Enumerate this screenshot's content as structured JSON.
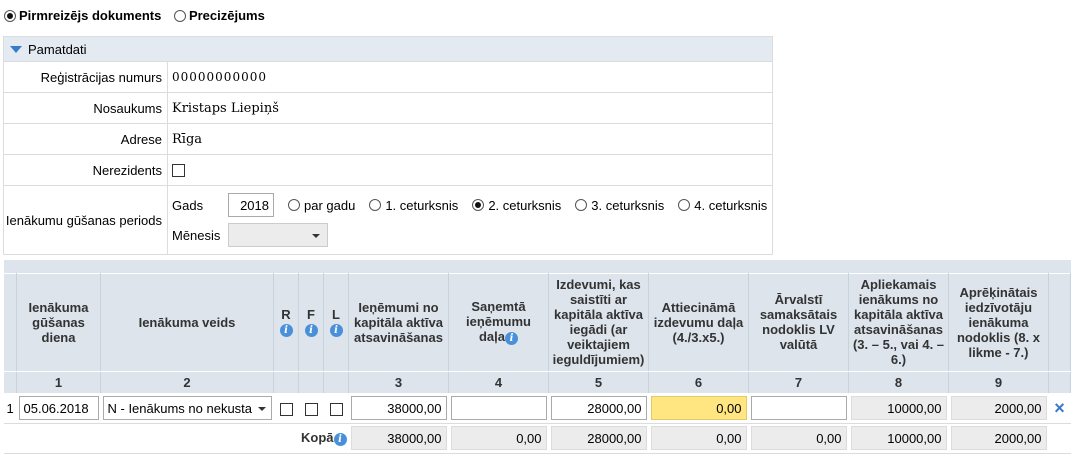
{
  "doc_type": {
    "options": [
      {
        "label": "Pirmreizējs dokuments",
        "selected": true
      },
      {
        "label": "Precizējums",
        "selected": false
      }
    ]
  },
  "pamatdati": {
    "title": "Pamatdati",
    "reg_label": "Reģistrācijas numurs",
    "reg_value": "00000000000",
    "name_label": "Nosaukums",
    "name_value": "Kristaps Liepiņš",
    "address_label": "Adrese",
    "address_value": "Rīga",
    "nonresident_label": "Nerezidents",
    "period_label": "Ienākumu gūšanas periods",
    "year_label": "Gads",
    "year_value": "2018",
    "period_options": [
      {
        "label": "par gadu",
        "selected": false
      },
      {
        "label": "1. ceturksnis",
        "selected": false
      },
      {
        "label": "2. ceturksnis",
        "selected": true
      },
      {
        "label": "3. ceturksnis",
        "selected": false
      },
      {
        "label": "4. ceturksnis",
        "selected": false
      }
    ],
    "month_label": "Mēnesis",
    "month_value": ""
  },
  "grid": {
    "headers": {
      "date": "Ienākuma gūšanas diena",
      "type": "Ienākuma veids",
      "r": "R",
      "f": "F",
      "l": "L",
      "c3": "Ieņēmumi no kapitāla aktīva atsavināšanas",
      "c4": "Saņemtā ieņēmumu daļa",
      "c5": "Izdevumi, kas saistīti ar kapitāla aktīva iegādi (ar veiktajiem ieguldījumiem)",
      "c6": "Attiecināmā izdevumu daļa (4./3.x5.)",
      "c7": "Ārvalstī samaksātais nodoklis LV valūtā",
      "c8": "Apliekamais ienākums no kapitāla aktīva atsavināšanas (3. – 5., vai 4. – 6.)",
      "c9": "Aprēķinātais iedzīvotāju ienākuma nodoklis (8. x likme - 7.)"
    },
    "numbers": [
      "1",
      "2",
      "3",
      "4",
      "5",
      "6",
      "7",
      "8",
      "9"
    ],
    "row": {
      "index": "1",
      "date": "05.06.2018",
      "type": "N - Ienākums no nekusta",
      "c3": "38000,00",
      "c4": "",
      "c5": "28000,00",
      "c6": "0,00",
      "c7": "",
      "c8": "10000,00",
      "c9": "2000,00"
    },
    "total": {
      "label": "Kopā",
      "c3": "38000,00",
      "c4": "0,00",
      "c5": "28000,00",
      "c6": "0,00",
      "c7": "0,00",
      "c8": "10000,00",
      "c9": "2000,00"
    },
    "delete_icon": "×"
  },
  "colors": {
    "accent": "#3a7bc8",
    "header_bg": "#dde4ec",
    "highlight": "#ffe680"
  }
}
